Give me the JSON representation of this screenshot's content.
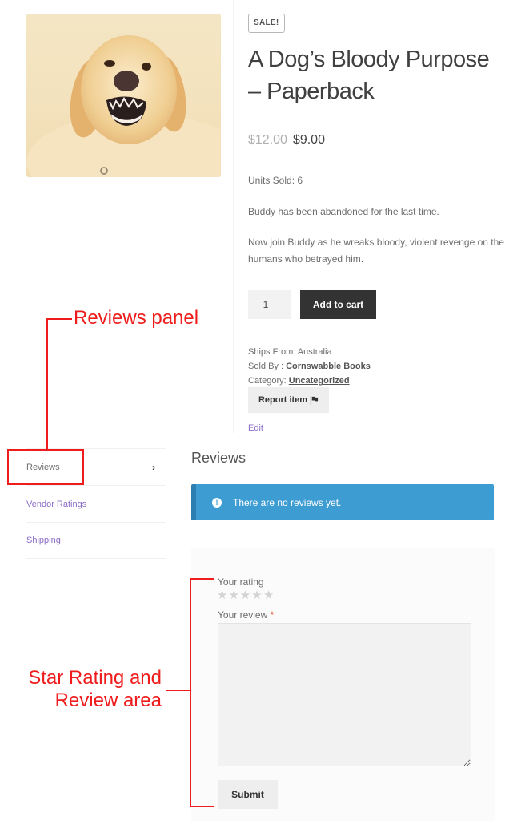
{
  "product": {
    "image_alt": "Snarling golden retriever",
    "sale_badge": "SALE!",
    "title": "A Dog’s Bloody Purpose – Paperback",
    "price_old": "$12.00",
    "price_new": "$9.00",
    "units_sold": "Units Sold: 6",
    "description": [
      "Buddy has been abandoned for the last time.",
      "Now join Buddy as he wreaks bloody, violent revenge on the humans who betrayed him."
    ],
    "quantity": "1",
    "add_to_cart_label": "Add to cart",
    "meta": {
      "ships_from": "Ships From: Australia",
      "sold_by_label": "Sold By : ",
      "sold_by_value": "Cornswabble Books",
      "category_label": "Category: ",
      "category_value": "Uncategorized"
    },
    "report_label": "Report item",
    "edit_label": "Edit"
  },
  "tabs": [
    {
      "label": "Reviews",
      "active": true,
      "icon": "chevron-right-icon",
      "chevron": "›"
    },
    {
      "label": "Vendor Ratings",
      "active": false
    },
    {
      "label": "Shipping",
      "active": false
    }
  ],
  "reviews": {
    "heading": "Reviews",
    "notice_icon": "!",
    "notice_text": "There are no reviews yet.",
    "rating_label": "Your rating",
    "rating_value": 0,
    "rating_max": 5,
    "star_glyph": "★",
    "review_label": "Your review",
    "required_marker": "*",
    "review_value": "",
    "submit_label": "Submit"
  },
  "annotations": {
    "reviews_panel": "Reviews panel",
    "star_rating_line1": "Star Rating and",
    "star_rating_line2": "Review area",
    "color": "#ee1c1c"
  },
  "colors": {
    "accent_link": "#8a6cc6",
    "notice_bg": "#3d9cd2",
    "button_dark": "#333333"
  }
}
